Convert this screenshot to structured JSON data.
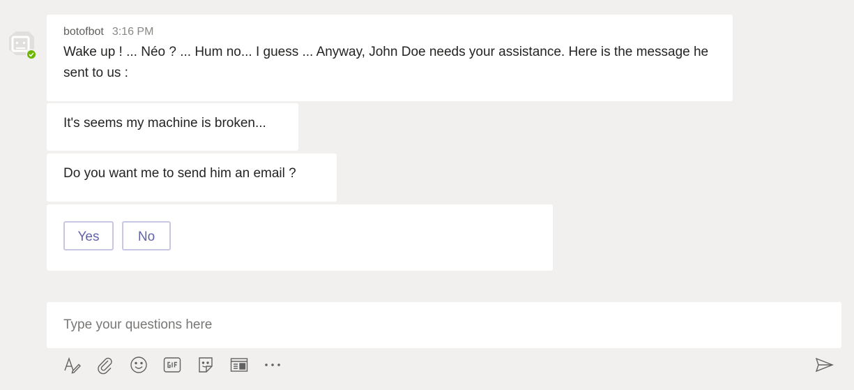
{
  "avatar": {
    "icon": "bot-icon",
    "status": "available",
    "status_color": "#6bb700"
  },
  "messages": {
    "main": {
      "sender": "botofbot",
      "time": "3:16 PM",
      "text": "Wake up ! ... Néo ? ... Hum no... I guess ... Anyway, John Doe needs your assistance. Here is the message he sent to us :"
    },
    "quoted": {
      "text": "It's seems my machine is broken..."
    },
    "question": {
      "text": "Do you want me to send him an email ?"
    },
    "actions": {
      "yes_label": "Yes",
      "no_label": "No",
      "accent_color": "#6264a7"
    }
  },
  "compose": {
    "placeholder": "Type your questions here",
    "value": "",
    "toolbar": [
      "format-icon",
      "attach-icon",
      "emoji-icon",
      "gif-icon",
      "sticker-icon",
      "meet-icon",
      "more-icon"
    ],
    "send_icon": "send-icon"
  }
}
